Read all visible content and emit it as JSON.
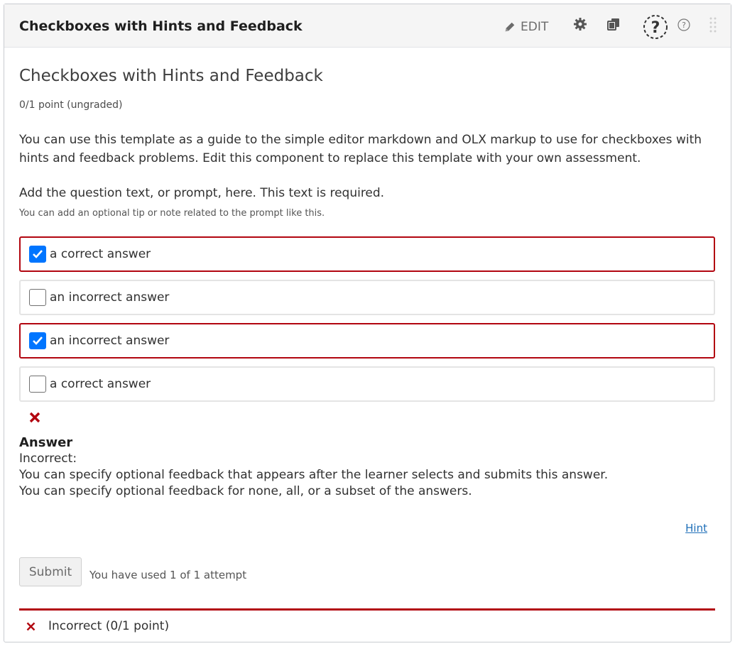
{
  "header": {
    "title": "Checkboxes with Hints and Feedback",
    "edit_label": "EDIT"
  },
  "problem": {
    "title": "Checkboxes with Hints and Feedback",
    "points": "0/1 point (ungraded)",
    "intro": "You can use this template as a guide to the simple editor markdown and OLX markup to use for checkboxes with hints and feedback problems. Edit this component to replace this template with your own assessment.",
    "prompt": "Add the question text, or prompt, here. This text is required.",
    "tip": "You can add an optional tip or note related to the prompt like this.",
    "choices": [
      {
        "label": "a correct answer",
        "checked": true
      },
      {
        "label": "an incorrect answer",
        "checked": false
      },
      {
        "label": "an incorrect answer",
        "checked": true
      },
      {
        "label": "a correct answer",
        "checked": false
      }
    ],
    "answer": {
      "title": "Answer",
      "status": "Incorrect:",
      "feedback1": "You can specify optional feedback that appears after the learner selects and submits this answer.",
      "feedback2": "You can specify optional feedback for none, all, or a subset of the answers."
    },
    "hint_label": "Hint",
    "submit_label": "Submit",
    "attempts": "You have used 1 of 1 attempt",
    "result": "Incorrect (0/1 point)"
  },
  "colors": {
    "error": "#b20610",
    "checkbox": "#0075ff",
    "link": "#1f6fb8"
  },
  "icons": [
    "pencil-icon",
    "gear-icon",
    "duplicate-icon",
    "help-circle-icon",
    "help-icon",
    "drag-handle-icon",
    "close-icon"
  ]
}
